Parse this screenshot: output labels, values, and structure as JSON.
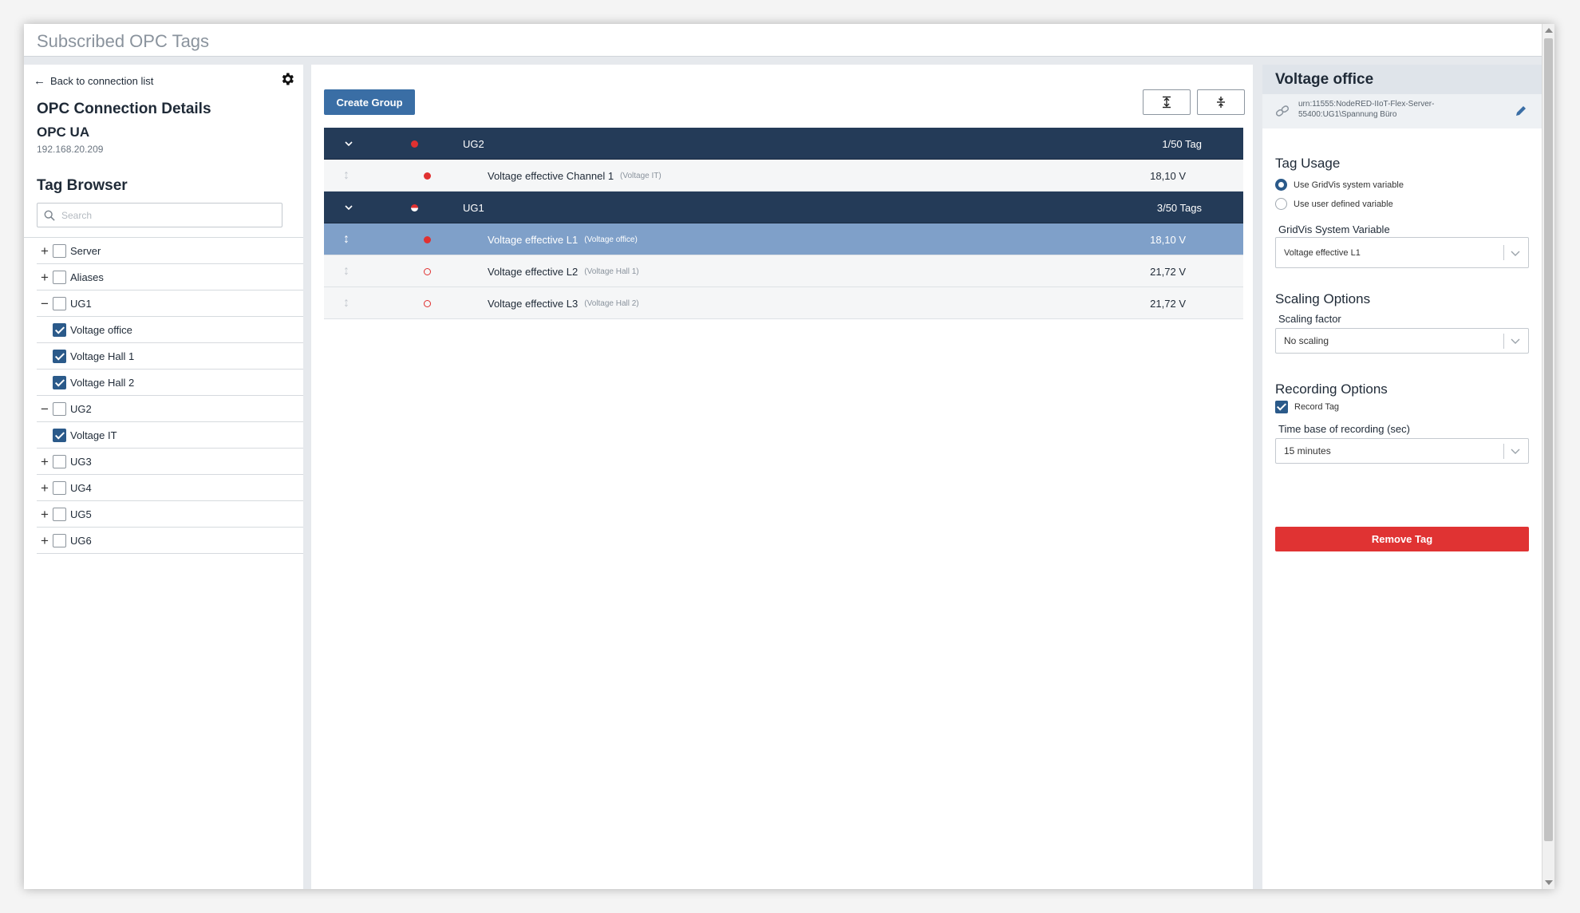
{
  "window": {
    "title": "Subscribed OPC Tags"
  },
  "left": {
    "back_label": "Back to connection list",
    "connection_title": "OPC Connection Details",
    "connection_type": "OPC UA",
    "connection_ip": "192.168.20.209",
    "tag_browser_title": "Tag Browser",
    "search_placeholder": "Search",
    "tree": [
      {
        "label": "Server",
        "expander": "+",
        "checked": false,
        "child": false
      },
      {
        "label": "Aliases",
        "expander": "+",
        "checked": false,
        "child": false
      },
      {
        "label": "UG1",
        "expander": "−",
        "checked": false,
        "child": false
      },
      {
        "label": "Voltage office",
        "expander": "",
        "checked": true,
        "child": true
      },
      {
        "label": "Voltage Hall 1",
        "expander": "",
        "checked": true,
        "child": true
      },
      {
        "label": "Voltage Hall 2",
        "expander": "",
        "checked": true,
        "child": true
      },
      {
        "label": "UG2",
        "expander": "−",
        "checked": false,
        "child": false
      },
      {
        "label": "Voltage IT",
        "expander": "",
        "checked": true,
        "child": true
      },
      {
        "label": "UG3",
        "expander": "+",
        "checked": false,
        "child": false
      },
      {
        "label": "UG4",
        "expander": "+",
        "checked": false,
        "child": false
      },
      {
        "label": "UG5",
        "expander": "+",
        "checked": false,
        "child": false
      },
      {
        "label": "UG6",
        "expander": "+",
        "checked": false,
        "child": false
      }
    ]
  },
  "middle": {
    "create_group_label": "Create Group",
    "groups": [
      {
        "name": "UG2",
        "count": "1/50 Tag",
        "status": "full",
        "tags": [
          {
            "name": "Voltage effective Channel 1",
            "alias": "(Voltage IT)",
            "value": "18,10 V",
            "status": "full",
            "selected": false
          }
        ]
      },
      {
        "name": "UG1",
        "count": "3/50 Tags",
        "status": "half",
        "tags": [
          {
            "name": "Voltage effective L1",
            "alias": "(Voltage office)",
            "value": "18,10 V",
            "status": "full",
            "selected": true
          },
          {
            "name": "Voltage effective L2",
            "alias": "(Voltage Hall 1)",
            "value": "21,72 V",
            "status": "outline",
            "selected": false
          },
          {
            "name": "Voltage effective L3",
            "alias": "(Voltage Hall 2)",
            "value": "21,72 V",
            "status": "outline",
            "selected": false
          }
        ]
      }
    ]
  },
  "right": {
    "title": "Voltage office",
    "urn": "urn:11555:NodeRED-IIoT-Flex-Server-55400:UG1\\Spannung Büro",
    "tag_usage_title": "Tag Usage",
    "radio_system": "Use GridVis system variable",
    "radio_user": "Use user defined variable",
    "gridvis_label": "GridVis System Variable",
    "gridvis_value": "Voltage effective L1",
    "scaling_title": "Scaling Options",
    "scaling_label": "Scaling factor",
    "scaling_value": "No scaling",
    "recording_title": "Recording Options",
    "record_tag_label": "Record Tag",
    "timebase_label": "Time base of recording (sec)",
    "timebase_value": "15 minutes",
    "remove_label": "Remove Tag"
  },
  "colors": {
    "primary": "#3a6ea5",
    "group_header": "#243b58",
    "selected_row": "#7fa0c9",
    "danger": "#e03333",
    "status_red": "#e03131"
  }
}
